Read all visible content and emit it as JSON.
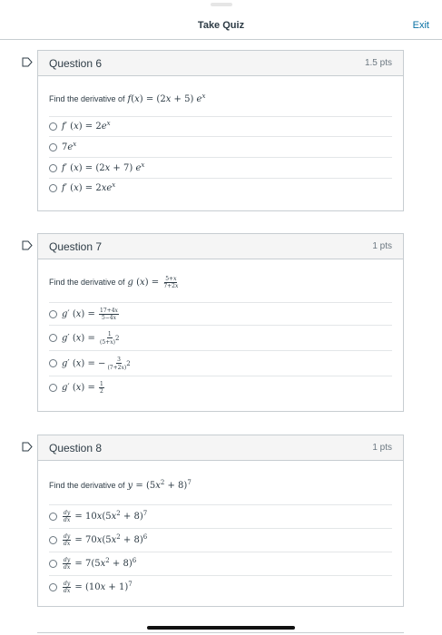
{
  "header": {
    "title": "Take Quiz",
    "exit_label": "Exit"
  },
  "questions": [
    {
      "title": "Question 6",
      "points": "1.5 pts",
      "prompt_lead": "Find the derivative of",
      "prompt_expr": "f(x) = (2x + 5) e^x",
      "answers": [
        "f′(x) = 2e^x",
        "7e^x",
        "f′(x) = (2x + 7) e^x",
        "f′(x) = 2xe^x"
      ]
    },
    {
      "title": "Question 7",
      "points": "1 pts",
      "prompt_lead": "Find the derivative of",
      "prompt_expr": "g(x) = (5+x)/(7+2x)",
      "answers": [
        "g′(x) = (17+4x)/(5−4x)",
        "g′(x) = 1/(5+x)^2",
        "g′(x) = −3/(7+2x)^2",
        "g′(x) = 1/2"
      ]
    },
    {
      "title": "Question 8",
      "points": "1 pts",
      "prompt_lead": "Find the derivative of",
      "prompt_expr": "y = (5x^2 + 8)^7",
      "answers": [
        "dy/dx = 10x(5x^2 + 8)^7",
        "dy/dx = 70x(5x^2 + 8)^6",
        "dy/dx = 7(5x^2 + 8)^6",
        "dy/dx = (10x + 1)^7"
      ]
    }
  ]
}
